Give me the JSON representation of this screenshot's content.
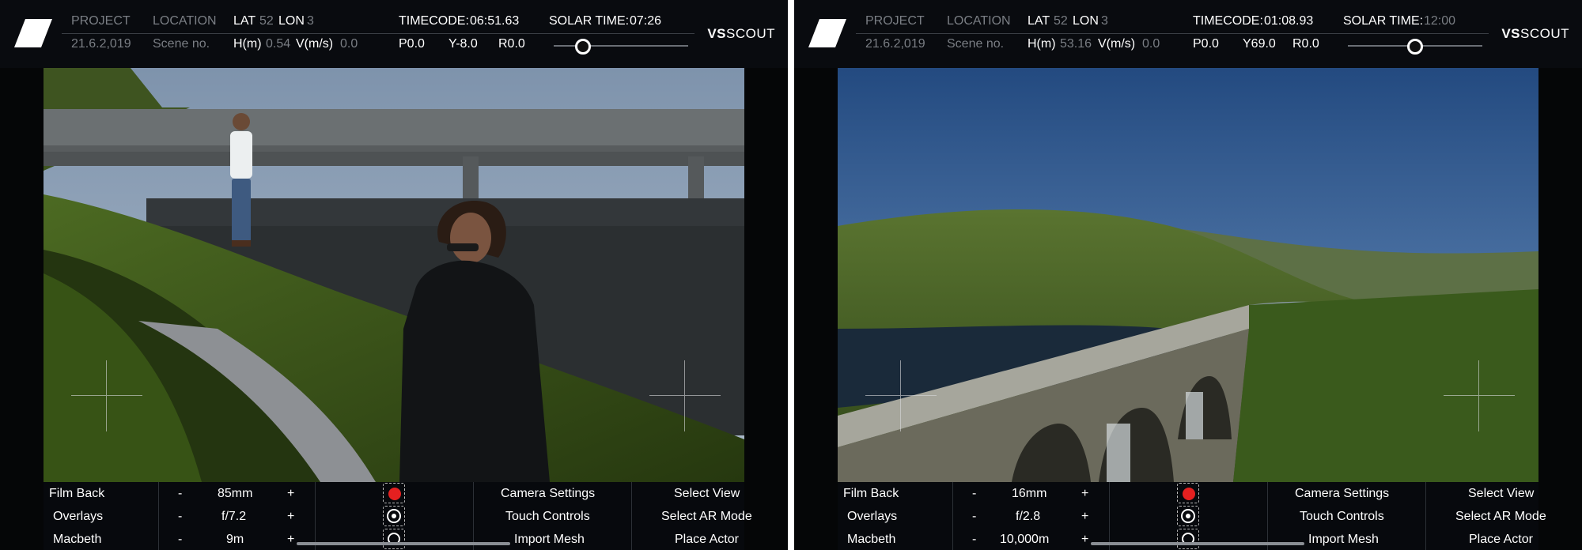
{
  "panels": [
    {
      "header": {
        "project_label": "PROJECT",
        "location_label": "LOCATION",
        "date": "21.6.2,019",
        "scene": "Scene no.",
        "lat_label": "LAT",
        "lat_value": "52",
        "lon_label": "LON",
        "lon_value": "3",
        "h_label": "H(m)",
        "h_value": "0.54",
        "v_label": "V(m/s)",
        "v_value": "0.0",
        "timecode_label": "TIMECODE:",
        "timecode_value": "06:51.63",
        "solar_label": "SOLAR TIME:",
        "solar_value": "07:26",
        "p_value": "P0.0",
        "y_value": "Y-8.0",
        "r_value": "R0.0",
        "solar_slider_fraction": 0.22,
        "brand_bold": "VS",
        "brand_rest": "SCOUT"
      },
      "controls": {
        "film_back_label": "Film Back",
        "film_back_value": "85",
        "film_back_unit": "mm",
        "overlays_label": "Overlays",
        "overlays_prefix": "f/",
        "overlays_value": "7.2",
        "macbeth_label": "Macbeth",
        "macbeth_value": "9",
        "macbeth_unit": "m",
        "minus": "-",
        "plus": "+",
        "camera_settings": "Camera Settings",
        "touch_controls": "Touch Controls",
        "import_mesh": "Import Mesh",
        "select_view": "Select View",
        "select_ar_mode": "Select AR Mode",
        "place_actor": "Place Actor"
      }
    },
    {
      "header": {
        "project_label": "PROJECT",
        "location_label": "LOCATION",
        "date": "21.6.2,019",
        "scene": "Scene no.",
        "lat_label": "LAT",
        "lat_value": "52",
        "lon_label": "LON",
        "lon_value": "3",
        "h_label": "H(m)",
        "h_value": "53.16",
        "v_label": "V(m/s)",
        "v_value": "0.0",
        "timecode_label": "TIMECODE:",
        "timecode_value": "01:08.93",
        "solar_label": "SOLAR TIME:",
        "solar_value": "12:00",
        "p_value": "P0.0",
        "y_value": "Y69.0",
        "r_value": "R0.0",
        "solar_slider_fraction": 0.5,
        "brand_bold": "VS",
        "brand_rest": "SCOUT"
      },
      "controls": {
        "film_back_label": "Film Back",
        "film_back_value": "16",
        "film_back_unit": "mm",
        "overlays_label": "Overlays",
        "overlays_prefix": "f/",
        "overlays_value": "2.8",
        "macbeth_label": "Macbeth",
        "macbeth_value": "10,000",
        "macbeth_unit": "m",
        "minus": "-",
        "plus": "+",
        "camera_settings": "Camera Settings",
        "touch_controls": "Touch Controls",
        "import_mesh": "Import Mesh",
        "select_view": "Select View",
        "select_ar_mode": "Select AR Mode",
        "place_actor": "Place Actor"
      }
    }
  ],
  "colors": {
    "record": "#e52020",
    "hud_dim": "#7a7e84",
    "hud_bg": "#0a0c10"
  }
}
